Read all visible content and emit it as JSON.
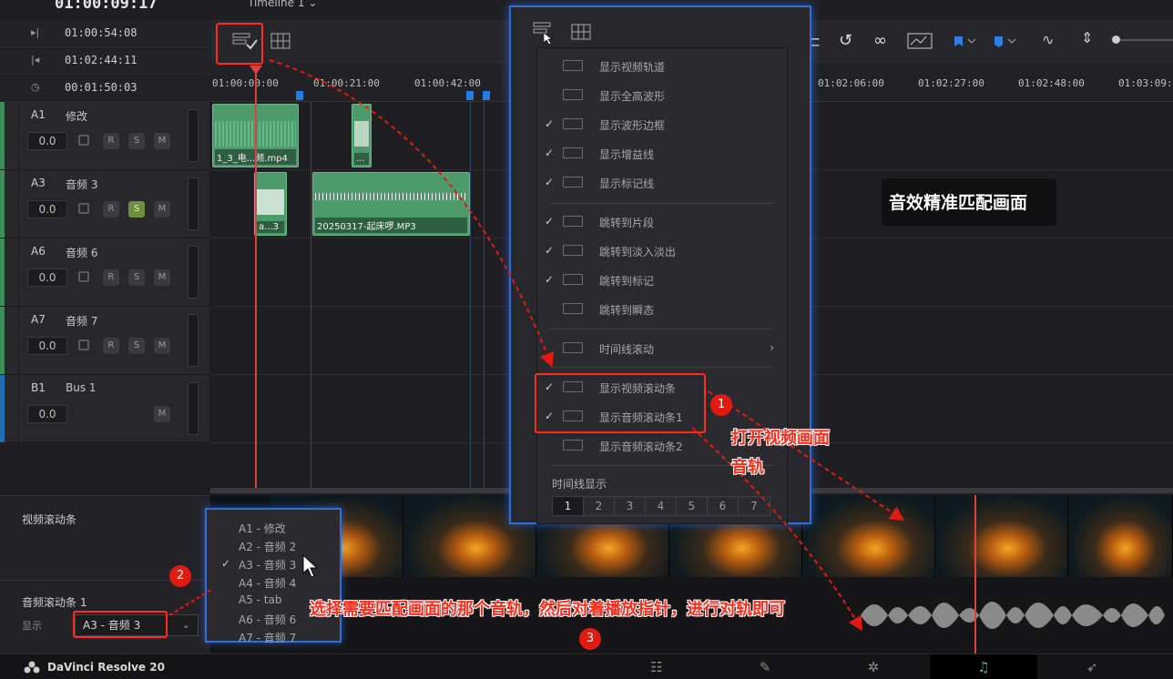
{
  "header": {
    "main_timecode": "01:00:09:17",
    "timeline_name": "Timeline 1 ⌄",
    "rows": [
      {
        "icon": "▸|",
        "value": "01:00:54:08"
      },
      {
        "icon": "|◂",
        "value": "01:02:44:11"
      },
      {
        "icon": "◷",
        "value": "00:01:50:03"
      }
    ]
  },
  "ruler": {
    "labels": [
      "01:00:00:00",
      "01:00:21:00",
      "01:00:42:00",
      "01:02:06:00",
      "01:02:27:00",
      "01:02:48:00",
      "01:03:09:0"
    ]
  },
  "tracks": [
    {
      "id": "A1",
      "name": "修改",
      "vol": "0.0",
      "r": "R",
      "s": "S",
      "m": "M"
    },
    {
      "id": "A3",
      "name": "音频 3",
      "vol": "0.0",
      "r": "R",
      "s": "S",
      "m": "M"
    },
    {
      "id": "A6",
      "name": "音频 6",
      "vol": "0.0",
      "r": "R",
      "s": "S",
      "m": "M"
    },
    {
      "id": "A7",
      "name": "音频 7",
      "vol": "0.0",
      "r": "R",
      "s": "S",
      "m": "M"
    },
    {
      "id": "B1",
      "name": "Bus 1",
      "vol": "0.0",
      "m": "M"
    }
  ],
  "clips": {
    "a1_1": "1_3_电...频.mp4",
    "a1_2": "...",
    "a3_1": "a...3",
    "a3_2": "20250317-起床啰.MP3",
    "peek": "1_3"
  },
  "lower": {
    "video_scroll_label": "视频滚动条",
    "audio_scroll_label": "音频滚动条 1",
    "display_label": "显示",
    "selected_track": "A3 - 音频 3",
    "chevron": "⌄"
  },
  "popup_menu": {
    "items": [
      {
        "check": "",
        "label": "显示视频轨道"
      },
      {
        "check": "",
        "label": "显示全高波形"
      },
      {
        "check": "✓",
        "label": "显示波形边框"
      },
      {
        "check": "✓",
        "label": "显示增益线"
      },
      {
        "check": "✓",
        "label": "显示标记线"
      },
      {
        "check": "✓",
        "label": "跳转到片段"
      },
      {
        "check": "✓",
        "label": "跳转到淡入淡出"
      },
      {
        "check": "✓",
        "label": "跳转到标记"
      },
      {
        "check": "",
        "label": "跳转到瞬态"
      },
      {
        "check": "",
        "label": "时间线滚动",
        "arrow": "›"
      },
      {
        "check": "✓",
        "label": "显示视频滚动条"
      },
      {
        "check": "✓",
        "label": "显示音频滚动条1"
      },
      {
        "check": "",
        "label": "显示音频滚动条2"
      }
    ],
    "timeline_display_label": "时间线显示",
    "timeline_display_options": [
      "1",
      "2",
      "3",
      "4",
      "5",
      "6",
      "7"
    ],
    "timeline_display_selected": "1"
  },
  "track_dropdown": {
    "options": [
      {
        "check": "",
        "label": "A1 - 修改"
      },
      {
        "check": "",
        "label": "A2 - 音频 2"
      },
      {
        "check": "✓",
        "label": "A3 - 音频 3"
      },
      {
        "check": "",
        "label": "A4 - 音频 4"
      },
      {
        "check": "",
        "label": "A5 - tab"
      },
      {
        "check": "",
        "label": "A6 - 音频 6"
      },
      {
        "check": "",
        "label": "A7 - 音频 7"
      }
    ]
  },
  "annotations": {
    "badge_1": "1",
    "badge_2": "2",
    "badge_3": "3",
    "note_1_line1": "打开视频画面",
    "note_1_line2": "音轨",
    "note_3": "选择需要匹配画面的那个音轨，然后对着播放指针，进行对轨即可",
    "title_caption": "音效精准匹配画面"
  },
  "footer": {
    "brand": "DaVinci Resolve 20"
  },
  "colors": {
    "accent_blue": "#2f6fd6",
    "clip_green": "#4d9b6a",
    "annotation_red": "#ff2b1c",
    "playhead_red": "#e04040"
  }
}
